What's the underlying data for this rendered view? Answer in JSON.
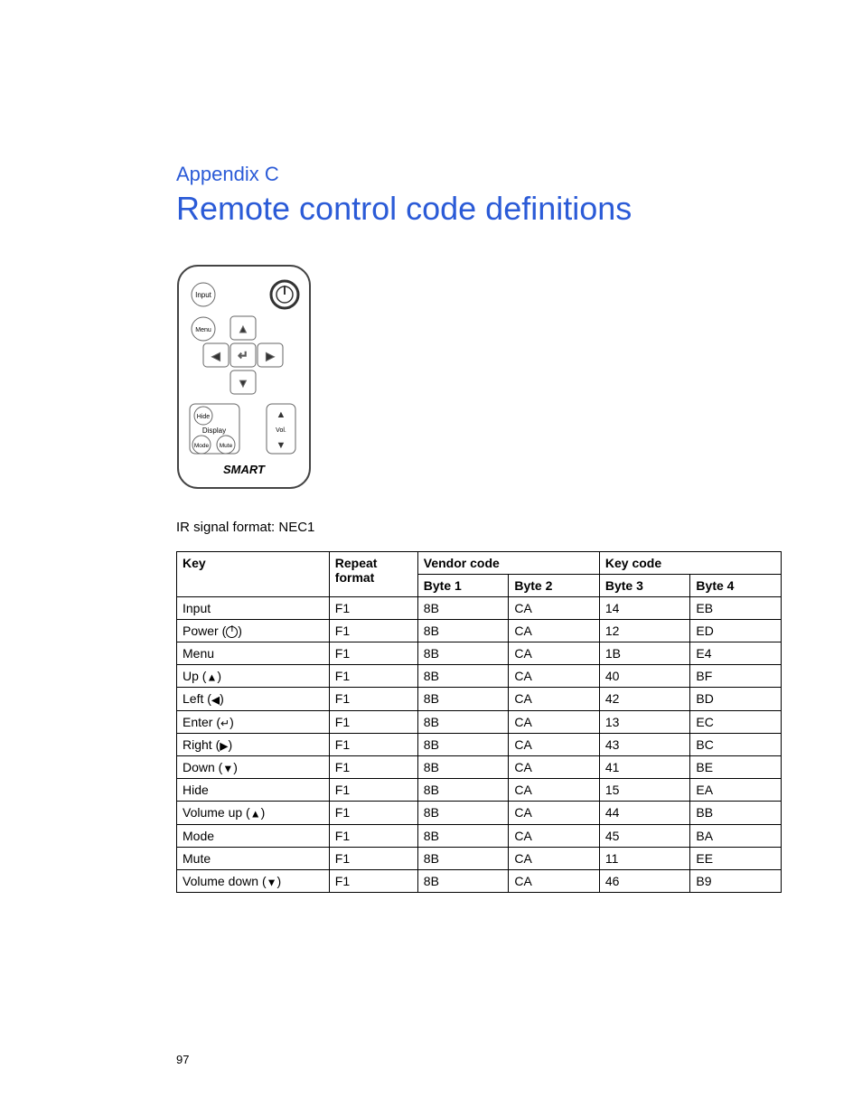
{
  "header": {
    "appendix": "Appendix  C",
    "title": "Remote control code definitions"
  },
  "remote": {
    "buttons": {
      "input": "Input",
      "menu": "Menu",
      "hide": "Hide",
      "display": "Display",
      "mode": "Mode",
      "mute": "Mute",
      "vol": "Vol.",
      "brand": "SMART"
    }
  },
  "signal_format": "IR signal format: NEC1",
  "table": {
    "headers": {
      "key": "Key",
      "repeat_format": "Repeat format",
      "vendor_code": "Vendor code",
      "key_code": "Key code",
      "byte1": "Byte 1",
      "byte2": "Byte 2",
      "byte3": "Byte 3",
      "byte4": "Byte 4"
    },
    "rows": [
      {
        "key": "Input",
        "glyph": "",
        "repeat": "F1",
        "b1": "8B",
        "b2": "CA",
        "b3": "14",
        "b4": "EB"
      },
      {
        "key": "Power",
        "glyph": "power",
        "repeat": "F1",
        "b1": "8B",
        "b2": "CA",
        "b3": "12",
        "b4": "ED"
      },
      {
        "key": "Menu",
        "glyph": "",
        "repeat": "F1",
        "b1": "8B",
        "b2": "CA",
        "b3": "1B",
        "b4": "E4"
      },
      {
        "key": "Up",
        "glyph": "▲",
        "repeat": "F1",
        "b1": "8B",
        "b2": "CA",
        "b3": "40",
        "b4": "BF"
      },
      {
        "key": "Left",
        "glyph": "◀",
        "repeat": "F1",
        "b1": "8B",
        "b2": "CA",
        "b3": "42",
        "b4": "BD"
      },
      {
        "key": "Enter",
        "glyph": "↵",
        "repeat": "F1",
        "b1": "8B",
        "b2": "CA",
        "b3": "13",
        "b4": "EC"
      },
      {
        "key": "Right",
        "glyph": "▶",
        "repeat": "F1",
        "b1": "8B",
        "b2": "CA",
        "b3": "43",
        "b4": "BC"
      },
      {
        "key": "Down",
        "glyph": "▼",
        "repeat": "F1",
        "b1": "8B",
        "b2": "CA",
        "b3": "41",
        "b4": "BE"
      },
      {
        "key": "Hide",
        "glyph": "",
        "repeat": "F1",
        "b1": "8B",
        "b2": "CA",
        "b3": "15",
        "b4": "EA"
      },
      {
        "key": "Volume up",
        "glyph": "▲",
        "repeat": "F1",
        "b1": "8B",
        "b2": "CA",
        "b3": "44",
        "b4": "BB"
      },
      {
        "key": "Mode",
        "glyph": "",
        "repeat": "F1",
        "b1": "8B",
        "b2": "CA",
        "b3": "45",
        "b4": "BA"
      },
      {
        "key": "Mute",
        "glyph": "",
        "repeat": "F1",
        "b1": "8B",
        "b2": "CA",
        "b3": "11",
        "b4": "EE"
      },
      {
        "key": "Volume down",
        "glyph": "▼",
        "repeat": "F1",
        "b1": "8B",
        "b2": "CA",
        "b3": "46",
        "b4": "B9"
      }
    ]
  },
  "page_number": "97"
}
